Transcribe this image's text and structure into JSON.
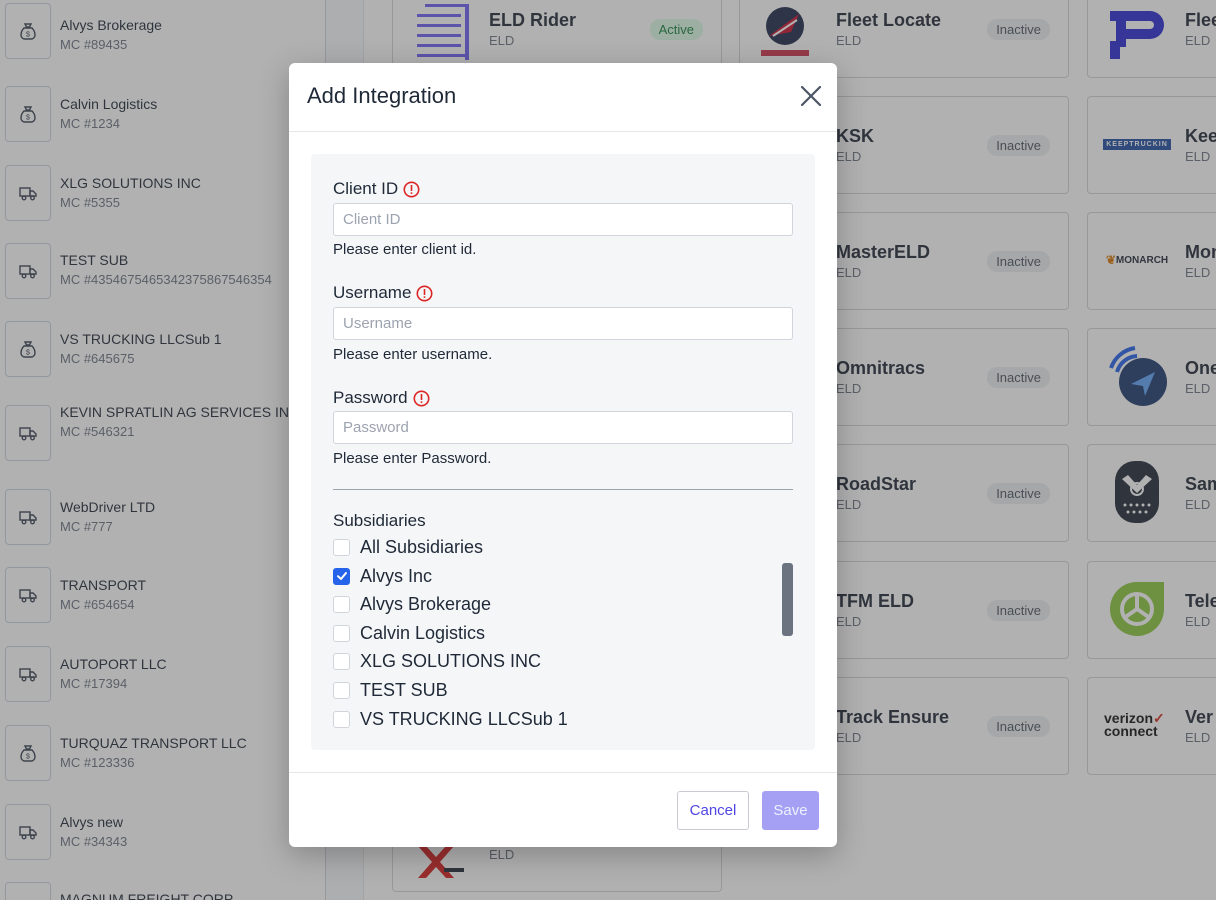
{
  "subsidiaries_list": [
    {
      "name": "Alvys Brokerage",
      "mc": "MC #89435",
      "icon": "money-bag-icon"
    },
    {
      "name": "Calvin Logistics",
      "mc": "MC #1234",
      "icon": "money-bag-icon"
    },
    {
      "name": "XLG SOLUTIONS INC",
      "mc": "MC #5355",
      "icon": "truck-icon"
    },
    {
      "name": "TEST SUB",
      "mc": "MC #4354675465342375867546354",
      "icon": "truck-icon"
    },
    {
      "name": "VS TRUCKING LLCSub 1",
      "mc": "MC #645675",
      "icon": "money-bag-icon"
    },
    {
      "name": "KEVIN SPRATLIN AG SERVICES INC",
      "mc": "MC #546321",
      "icon": "truck-icon"
    },
    {
      "name": "WebDriver LTD",
      "mc": "MC #777",
      "icon": "truck-icon"
    },
    {
      "name": "TRANSPORT",
      "mc": "MC #654654",
      "icon": "truck-icon"
    },
    {
      "name": "AUTOPORT LLC",
      "mc": "MC #17394",
      "icon": "truck-icon"
    },
    {
      "name": "TURQUAZ TRANSPORT LLC",
      "mc": "MC #123336",
      "icon": "money-bag-icon"
    },
    {
      "name": "Alvys new",
      "mc": "MC #34343",
      "icon": "truck-icon"
    },
    {
      "name": "MAGNUM FREIGHT CORP",
      "mc": "",
      "icon": "truck-icon"
    }
  ],
  "integrations": {
    "col1": [
      {
        "name": "ELD Rider",
        "type": "ELD",
        "status": "Active",
        "logo": "eld-rider-logo"
      }
    ],
    "col1_bottom": {
      "type": "ELD",
      "logo": "xeld-logo"
    },
    "col2": [
      {
        "name": "Fleet Locate",
        "type": "ELD",
        "status": "Inactive",
        "logo": "fleet-locate-logo"
      },
      {
        "name": "KSK",
        "type": "ELD",
        "status": "Inactive",
        "logo": "ksk-logo"
      },
      {
        "name": "MasterELD",
        "type": "ELD",
        "status": "Inactive",
        "logo": "master-eld-logo"
      },
      {
        "name": "Omnitracs",
        "type": "ELD",
        "status": "Inactive",
        "logo": "omnitracs-logo"
      },
      {
        "name": "RoadStar",
        "type": "ELD",
        "status": "Inactive",
        "logo": "roadstar-logo"
      },
      {
        "name": "TFM ELD",
        "type": "ELD",
        "status": "Inactive",
        "logo": "tfm-eld-logo"
      },
      {
        "name": "Track Ensure",
        "type": "ELD",
        "status": "Inactive",
        "logo": "track-ensure-logo"
      }
    ],
    "col3": [
      {
        "name": "Flee",
        "type": "ELD",
        "logo": "fleet-pulse-logo"
      },
      {
        "name": "Kee",
        "type": "ELD",
        "logo": "keeptruckin-logo",
        "logo_text": "KEEPTRUCKIN"
      },
      {
        "name": "Mon",
        "type": "ELD",
        "logo": "monarch-logo",
        "logo_text": "MONARCH"
      },
      {
        "name": "One",
        "type": "ELD",
        "logo": "one-step-logo"
      },
      {
        "name": "Sam",
        "type": "ELD",
        "logo": "samsara-logo"
      },
      {
        "name": "Tele",
        "type": "ELD",
        "logo": "teletrac-logo"
      },
      {
        "name": "Ver",
        "type": "ELD",
        "logo": "verizon-connect-logo",
        "logo_text_1": "verizon",
        "logo_text_2": "connect"
      }
    ]
  },
  "modal": {
    "title": "Add Integration",
    "client_id": {
      "label": "Client ID",
      "placeholder": "Client ID",
      "value": "",
      "help": "Please enter client id."
    },
    "username": {
      "label": "Username",
      "placeholder": "Username",
      "value": "",
      "help": "Please enter username."
    },
    "password": {
      "label": "Password",
      "placeholder": "Password",
      "value": "",
      "help": "Please enter Password."
    },
    "subsidiaries_title": "Subsidiaries",
    "subsidiary_options": [
      {
        "label": "All Subsidiaries",
        "checked": false
      },
      {
        "label": "Alvys Inc",
        "checked": true
      },
      {
        "label": "Alvys Brokerage",
        "checked": false
      },
      {
        "label": "Calvin Logistics",
        "checked": false
      },
      {
        "label": "XLG SOLUTIONS INC",
        "checked": false
      },
      {
        "label": "TEST SUB",
        "checked": false
      },
      {
        "label": "VS TRUCKING LLCSub 1",
        "checked": false
      }
    ],
    "cancel_label": "Cancel",
    "save_label": "Save"
  },
  "colors": {
    "accent": "#4f46e5",
    "checkbox_checked": "#2563eb",
    "save_disabled": "#a5a0f4",
    "warning": "#dc2626",
    "active_badge": "#dcfce7"
  }
}
